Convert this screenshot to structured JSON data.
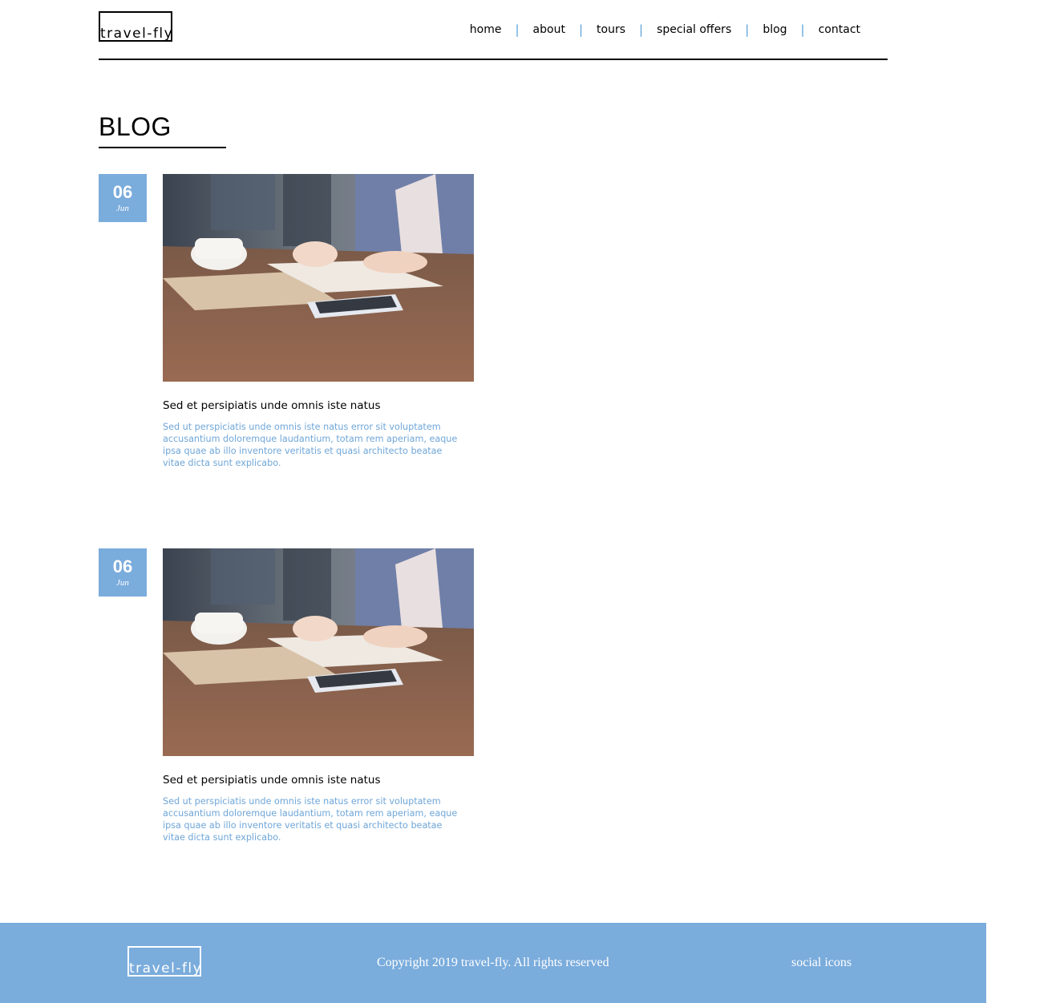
{
  "header": {
    "logo": "travel-fly",
    "nav": [
      {
        "label": "home"
      },
      {
        "label": "about"
      },
      {
        "label": "tours"
      },
      {
        "label": "special offers"
      },
      {
        "label": "blog"
      },
      {
        "label": "contact"
      }
    ],
    "separator": "|",
    "separator_color": "#5aa0d8"
  },
  "main": {
    "title": "BLOG",
    "posts": [
      {
        "day": "06",
        "month": "Jun",
        "image": "person-writing-notebook-coffee-phone",
        "title": "Sed et persipiatis unde omnis iste natus",
        "excerpt": "Sed ut perspiciatis unde omnis iste natus error sit voluptatem accusantium doloremque laudantium, totam rem aperiam, eaque ipsa quae ab illo inventore veritatis et quasi architecto beatae vitae dicta sunt explicabo."
      },
      {
        "day": "06",
        "month": "Jun",
        "image": "person-writing-notebook-coffee-phone",
        "title": "Sed et persipiatis unde omnis iste natus",
        "excerpt": "Sed ut perspiciatis unde omnis iste natus error sit voluptatem accusantium doloremque laudantium, totam rem aperiam, eaque ipsa quae ab illo inventore veritatis et quasi architecto beatae vitae dicta sunt explicabo."
      }
    ]
  },
  "footer": {
    "logo": "travel-fly",
    "copyright": "Copyright 2019 travel-fly. All rights reserved",
    "social": "social icons"
  },
  "colors": {
    "accent": "#7aacdc",
    "excerpt": "#6fa6d8"
  }
}
